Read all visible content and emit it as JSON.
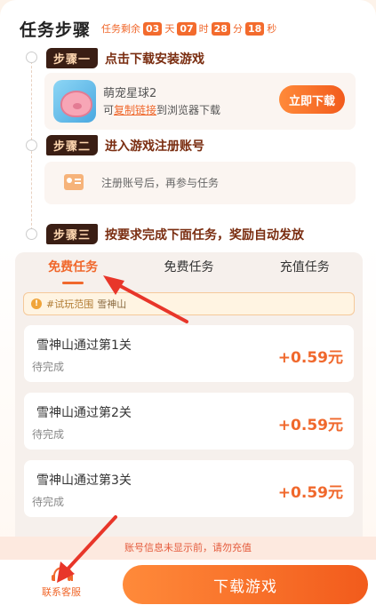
{
  "header": {
    "title": "任务步骤",
    "countdown_prefix": "任务剩余",
    "days": "03",
    "days_unit": "天",
    "hours": "07",
    "hours_unit": "时",
    "minutes": "28",
    "minutes_unit": "分",
    "seconds": "18",
    "seconds_unit": "秒"
  },
  "steps": [
    {
      "badge": "步骤一",
      "text": "点击下载安装游戏"
    },
    {
      "badge": "步骤二",
      "text": "进入游戏注册账号"
    },
    {
      "badge": "步骤三",
      "text": "按要求完成下面任务，奖励自动发放"
    }
  ],
  "game": {
    "name": "萌宠星球2",
    "sub_prefix": "可",
    "copy_link": "复制链接",
    "sub_suffix": "到浏览器下载",
    "download_button": "立即下载"
  },
  "register": {
    "text": "注册账号后，再参与任务"
  },
  "tabs": [
    "免费任务",
    "免费任务",
    "充值任务"
  ],
  "scope": {
    "hash": "#试玩范围",
    "value": "雪神山"
  },
  "tasks": [
    {
      "name": "雪神山通过第1关",
      "status": "待完成",
      "reward": "+0.59元"
    },
    {
      "name": "雪神山通过第2关",
      "status": "待完成",
      "reward": "+0.59元"
    },
    {
      "name": "雪神山通过第3关",
      "status": "待完成",
      "reward": "+0.59元"
    }
  ],
  "notice": "账号信息未显示前，请勿充值",
  "footer": {
    "service_label": "联系客服",
    "download_label": "下载游戏"
  },
  "colors": {
    "accent": "#f0682c",
    "badge_bg": "#3a1e14",
    "annotation_arrow": "#e8362a"
  },
  "icons": {
    "service": "headset-icon",
    "scope": "info-icon",
    "register": "id-card-icon"
  }
}
